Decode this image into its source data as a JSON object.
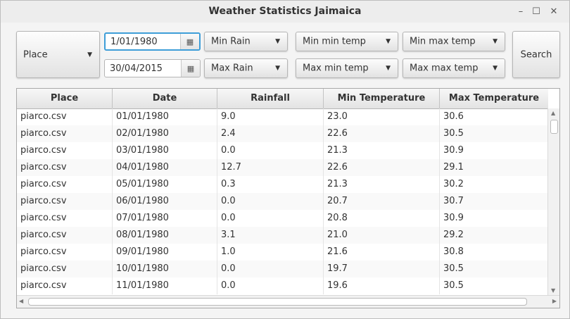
{
  "window": {
    "title": "Weather Statistics Jaimaica",
    "minimize_glyph": "–",
    "maximize_glyph": "☐",
    "close_glyph": "✕"
  },
  "controls": {
    "place_combo": "Place",
    "start_date": "1/01/1980",
    "end_date": "30/04/2015",
    "min_rain": "Min Rain",
    "max_rain": "Max Rain",
    "min_min_temp": "Min min temp",
    "max_min_temp": "Max min temp",
    "min_max_temp": "Min max temp",
    "max_max_temp": "Max max temp",
    "search": "Search",
    "calendar_glyph": "▦",
    "dropdown_glyph": "▼"
  },
  "table": {
    "columns": [
      "Place",
      "Date",
      "Rainfall",
      "Min Temperature",
      "Max Temperature"
    ],
    "rows": [
      [
        "piarco.csv",
        "01/01/1980",
        "9.0",
        "23.0",
        "30.6"
      ],
      [
        "piarco.csv",
        "02/01/1980",
        "2.4",
        "22.6",
        "30.5"
      ],
      [
        "piarco.csv",
        "03/01/1980",
        "0.0",
        "21.3",
        "30.9"
      ],
      [
        "piarco.csv",
        "04/01/1980",
        "12.7",
        "22.6",
        "29.1"
      ],
      [
        "piarco.csv",
        "05/01/1980",
        "0.3",
        "21.3",
        "30.2"
      ],
      [
        "piarco.csv",
        "06/01/1980",
        "0.0",
        "20.7",
        "30.7"
      ],
      [
        "piarco.csv",
        "07/01/1980",
        "0.0",
        "20.8",
        "30.9"
      ],
      [
        "piarco.csv",
        "08/01/1980",
        "3.1",
        "21.0",
        "29.2"
      ],
      [
        "piarco.csv",
        "09/01/1980",
        "1.0",
        "21.6",
        "30.8"
      ],
      [
        "piarco.csv",
        "10/01/1980",
        "0.0",
        "19.7",
        "30.5"
      ],
      [
        "piarco.csv",
        "11/01/1980",
        "0.0",
        "19.6",
        "30.5"
      ]
    ]
  },
  "icons": {
    "scroll_up": "▲",
    "scroll_down": "▼",
    "scroll_left": "◀",
    "scroll_right": "▶"
  }
}
